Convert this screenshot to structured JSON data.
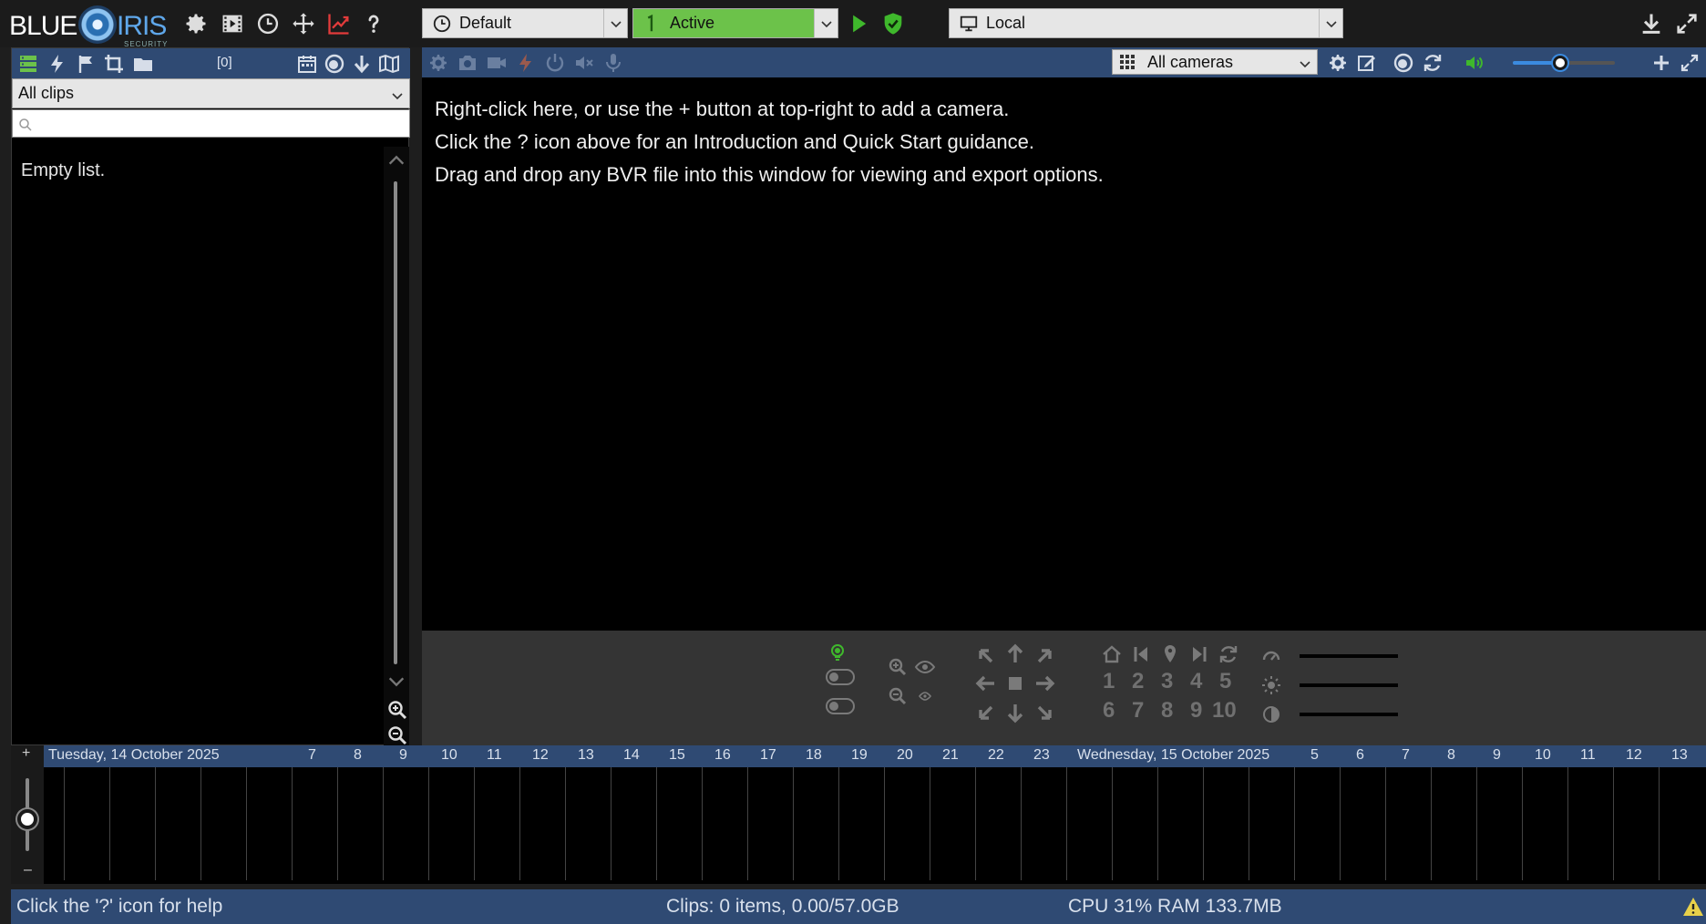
{
  "app": {
    "logo_word1": "BLUE",
    "logo_word2": "IRIS",
    "logo_tagline": "SECURITY"
  },
  "toolbar": {
    "profile": {
      "value": "Default",
      "icon": "clock-icon"
    },
    "schedule": {
      "value": "Active",
      "icon": "schedule-1-icon",
      "color": "#6cc24a"
    },
    "server": {
      "value": "Local",
      "icon": "monitor-icon"
    }
  },
  "clips": {
    "count_label": "[0]",
    "filter_value": "All clips",
    "search_placeholder": "",
    "empty_text": "Empty list."
  },
  "main": {
    "camera_group": "All cameras",
    "instructions": [
      "Right-click here, or use the + button at top-right to add a camera.",
      "Click the ? icon above for an Introduction and Quick Start guidance.",
      "Drag and drop any BVR file into this window for viewing and export options."
    ],
    "volume_level": 0.46
  },
  "ptz": {
    "presets": [
      "1",
      "2",
      "3",
      "4",
      "5",
      "6",
      "7",
      "8",
      "9",
      "10"
    ]
  },
  "timeline": {
    "day1": "Tuesday, 14 October 2025",
    "day1_hours": [
      "7",
      "8",
      "9",
      "10",
      "11",
      "12",
      "13",
      "14",
      "15",
      "16",
      "17",
      "18",
      "19",
      "20",
      "21",
      "22",
      "23"
    ],
    "day2": "Wednesday, 15 October 2025",
    "day2_hours": [
      "5",
      "6",
      "7",
      "8",
      "9",
      "10",
      "11",
      "12",
      "13"
    ],
    "zoom_plus": "+",
    "zoom_minus": "–"
  },
  "status": {
    "help": "Click the '?' icon for help",
    "clips": "Clips: 0 items, 0.00/57.0GB",
    "resources": "CPU 31% RAM 133.7MB"
  },
  "colors": {
    "panel_blue": "#2f4a73",
    "accent_green": "#6cc24a",
    "alert_red": "#e23b3b"
  }
}
